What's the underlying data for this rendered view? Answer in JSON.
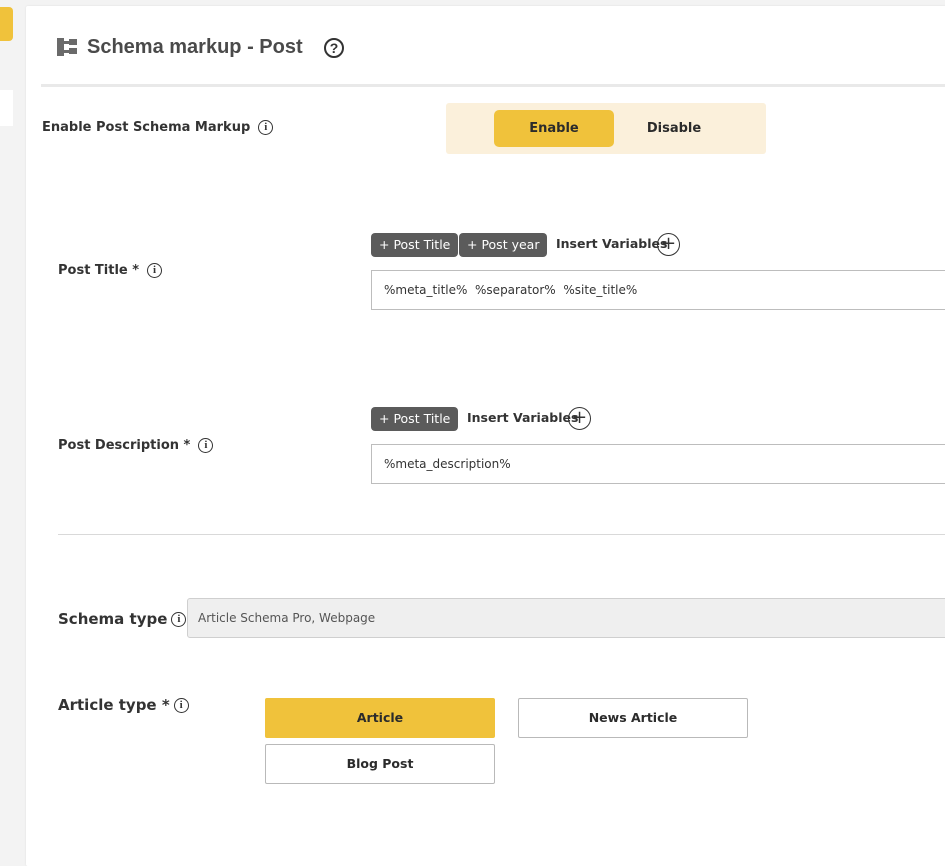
{
  "header": {
    "title": "Schema markup - Post",
    "help_icon": "?",
    "schema_icon": "sitemap-icon"
  },
  "enable_schema": {
    "label": "Enable Post Schema Markup",
    "options": [
      "Enable",
      "Disable"
    ],
    "selected": "Enable"
  },
  "post_title": {
    "label": "Post Title *",
    "chips": [
      "+ Post Title",
      "+ Post year"
    ],
    "insert_label": "Insert Variables",
    "value": "%meta_title%  %separator%  %site_title%"
  },
  "post_description": {
    "label": "Post Description *",
    "chips": [
      "+ Post Title"
    ],
    "insert_label": "Insert Variables",
    "value": "%meta_description%"
  },
  "schema_type": {
    "label": "Schema type",
    "value": "Article Schema Pro, Webpage"
  },
  "article_type": {
    "label": "Article type *",
    "options": [
      "Article",
      "News Article",
      "Blog Post"
    ],
    "selected": "Article"
  },
  "colors": {
    "accent": "#f0c23b",
    "toggle_bg": "#fbf0db",
    "chip_bg": "#5b5b5b"
  }
}
